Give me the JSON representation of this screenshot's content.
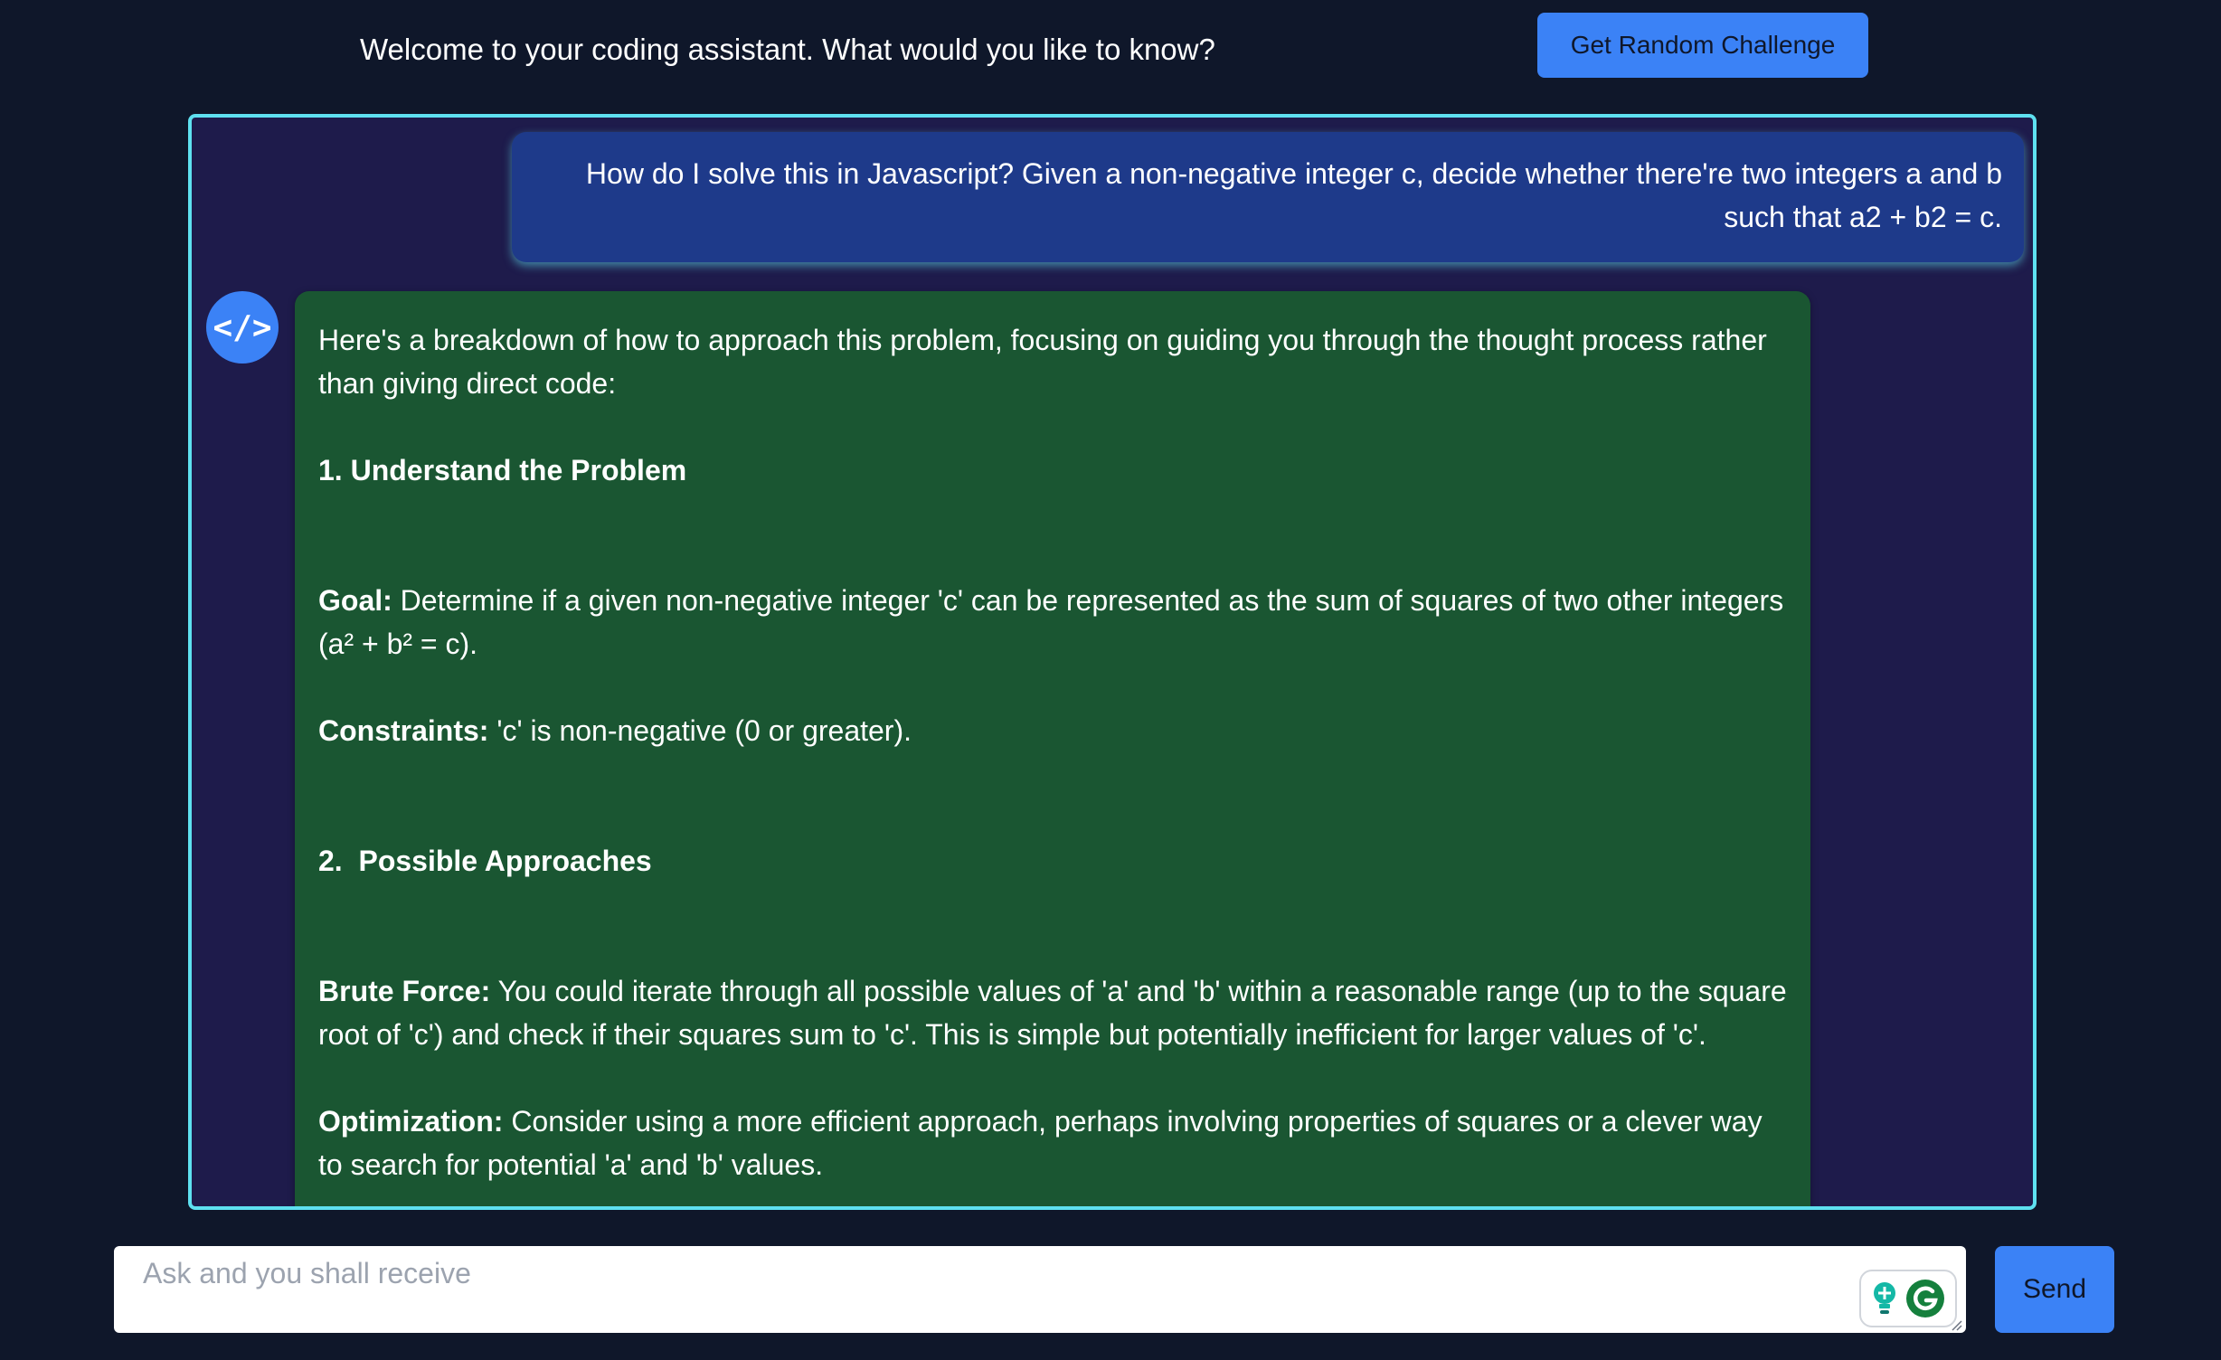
{
  "header": {
    "welcome_text": "Welcome to your coding assistant. What would you like to know?",
    "random_challenge_label": "Get Random Challenge"
  },
  "chat": {
    "user_message": "How do I solve this in Javascript? Given a non-negative integer c, decide whether there're two integers a and b such that a2 + b2 = c.",
    "bot_avatar_text": "</>",
    "bot_message": {
      "intro": "Here's a breakdown of how to approach this problem, focusing on guiding you through the thought process rather than giving direct code:",
      "section1_title": "1. Understand the Problem",
      "goal_term": "Goal:",
      "goal_text": " Determine if a given non-negative integer 'c' can be represented as the sum of squares of two other integers (a² + b² = c).",
      "constraints_term": "Constraints:",
      "constraints_text": " 'c' is non-negative (0 or greater).",
      "section2_title": "2.  Possible Approaches",
      "brute_force_term": "Brute Force:",
      "brute_force_text": " You could iterate through all possible values of 'a' and 'b' within a reasonable range (up to the square root of 'c') and check if their squares sum to 'c'. This is simple but potentially inefficient for larger values of 'c'.",
      "optimization_term": "Optimization:",
      "optimization_text": " Consider using a more efficient approach, perhaps involving properties of squares or a clever way to search for potential 'a' and 'b' values."
    }
  },
  "input": {
    "placeholder": "Ask and you shall receive",
    "value": "",
    "send_label": "Send"
  },
  "icons": {
    "bot_avatar": "code-icon",
    "grammar_assist": "lightbulb-icon",
    "grammar_logo": "grammarly-icon"
  },
  "colors": {
    "background": "#0f172a",
    "accent": "#3b82f6",
    "panel_border": "#5ee0f0",
    "panel_background": "#1e1b4b",
    "user_bubble": "#1e3a8a",
    "bot_bubble": "#1a5632"
  }
}
